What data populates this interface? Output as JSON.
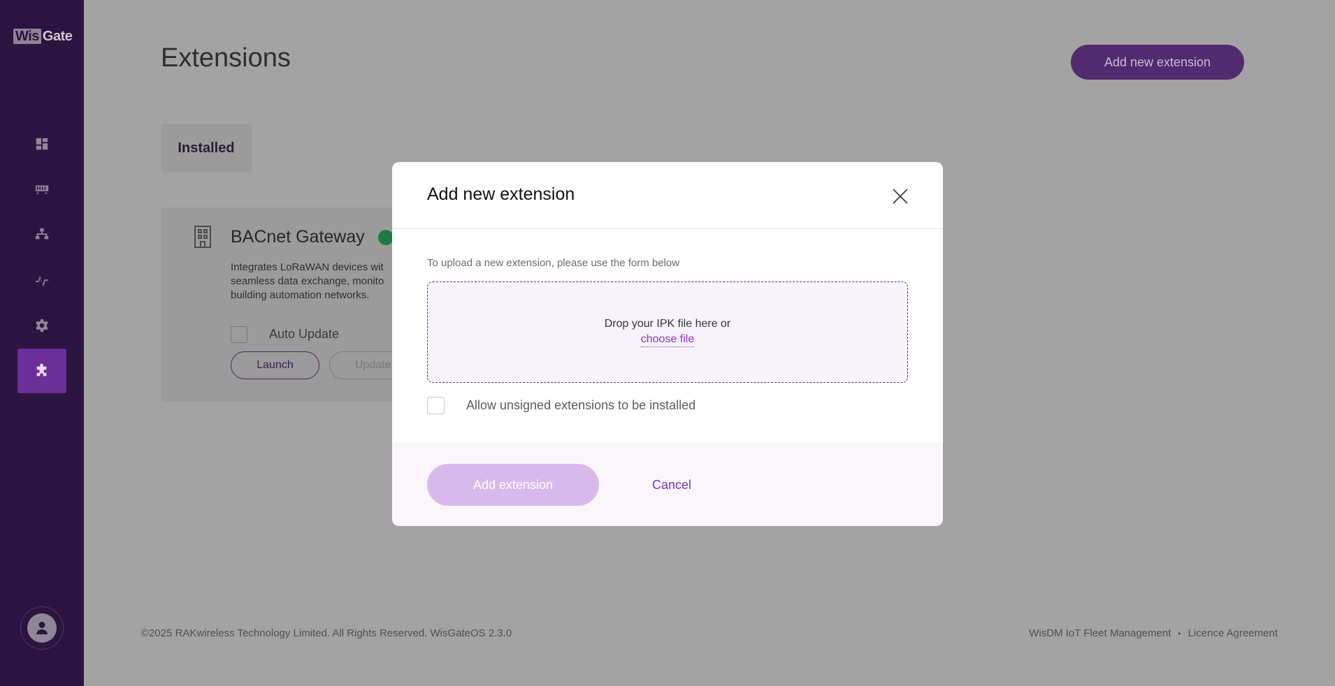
{
  "app": {
    "logo_wis": "Wis",
    "logo_gate": "Gate"
  },
  "sidebar": {
    "items": [
      {
        "name": "dashboard",
        "icon": "dashboard-icon"
      },
      {
        "name": "gateway",
        "icon": "gateway-icon"
      },
      {
        "name": "network",
        "icon": "network-icon"
      },
      {
        "name": "analytics",
        "icon": "activity-icon"
      },
      {
        "name": "settings",
        "icon": "gear-icon"
      },
      {
        "name": "extensions",
        "icon": "puzzle-icon",
        "active": true
      }
    ]
  },
  "page": {
    "title": "Extensions",
    "add_new_label": "Add new extension",
    "tabs": [
      {
        "label": "Installed"
      }
    ]
  },
  "extension": {
    "name": "BACnet Gateway",
    "status_color": "#1e7a44",
    "desc_lines": [
      "Integrates LoRaWAN devices wit",
      "seamless data exchange, monito",
      "building automation networks."
    ],
    "auto_update_label": "Auto Update",
    "launch_label": "Launch",
    "update_label": "Update"
  },
  "footer": {
    "copyright": "©2025 RAKwireless Technology Limited. All Rights Reserved. WisGateOS 2.3.0",
    "link_fleet": "WisDM IoT Fleet Management",
    "separator": "•",
    "link_licence": "Licence Agreement"
  },
  "modal": {
    "title": "Add new extension",
    "hint": "To upload a new extension, please use the form below",
    "drop_text": "Drop your IPK file here or",
    "choose_file": "choose file",
    "unsigned_label": "Allow unsigned extensions to be installed",
    "submit_label": "Add extension",
    "cancel_label": "Cancel"
  },
  "colors": {
    "sidebar": "#2a1440",
    "accent": "#7a2fb5",
    "disabled_button": "#d9b9ec"
  }
}
